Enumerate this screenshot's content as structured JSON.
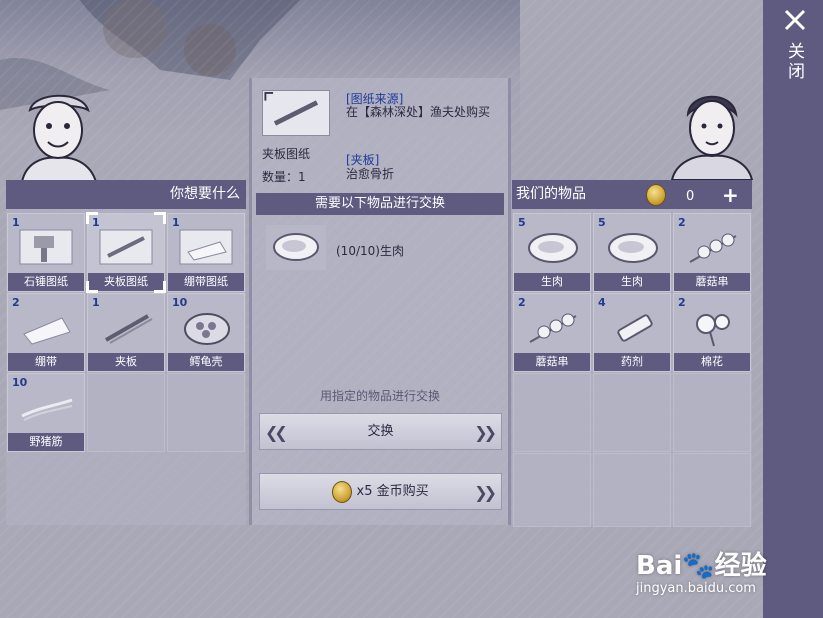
{
  "close": {
    "label": "关闭"
  },
  "left_panel": {
    "header": "你想要什么",
    "items": [
      {
        "count": "1",
        "name": "石锤图纸",
        "icon": "stone-hammer-blueprint-icon",
        "selected": false
      },
      {
        "count": "1",
        "name": "夹板图纸",
        "icon": "splint-blueprint-icon",
        "selected": true
      },
      {
        "count": "1",
        "name": "绷带图纸",
        "icon": "bandage-blueprint-icon",
        "selected": false
      },
      {
        "count": "2",
        "name": "绷带",
        "icon": "bandage-icon",
        "selected": false
      },
      {
        "count": "1",
        "name": "夹板",
        "icon": "splint-icon",
        "selected": false
      },
      {
        "count": "10",
        "name": "鳄龟壳",
        "icon": "turtle-shell-icon",
        "selected": false
      },
      {
        "count": "10",
        "name": "野猪筋",
        "icon": "boar-tendon-icon",
        "selected": false
      }
    ]
  },
  "detail": {
    "item_name": "夹板图纸",
    "quantity": "数量：1",
    "source_title": "[图纸来源]",
    "source_text": "在【森林深处】渔夫处购买",
    "effect_title": "[夹板]",
    "effect_text": "治愈骨折"
  },
  "requirement": {
    "header": "需要以下物品进行交换",
    "item_text": "(10/10)生肉",
    "icon": "raw-meat-icon"
  },
  "exchange": {
    "hint": "用指定的物品进行交换",
    "button_label": "交换",
    "buy_label": "x5 金币购买"
  },
  "right_panel": {
    "header": "我们的物品",
    "coins": "0",
    "items": [
      {
        "count": "5",
        "name": "生肉",
        "icon": "raw-meat-icon"
      },
      {
        "count": "5",
        "name": "生肉",
        "icon": "raw-meat-icon"
      },
      {
        "count": "2",
        "name": "蘑菇串",
        "icon": "mushroom-skewer-icon"
      },
      {
        "count": "2",
        "name": "蘑菇串",
        "icon": "mushroom-skewer-icon"
      },
      {
        "count": "4",
        "name": "药剂",
        "icon": "medicine-icon"
      },
      {
        "count": "2",
        "name": "棉花",
        "icon": "cotton-icon"
      }
    ]
  },
  "watermark": {
    "brand": "Bai",
    "suffix": "经验",
    "url": "jingyan.baidu.com"
  }
}
